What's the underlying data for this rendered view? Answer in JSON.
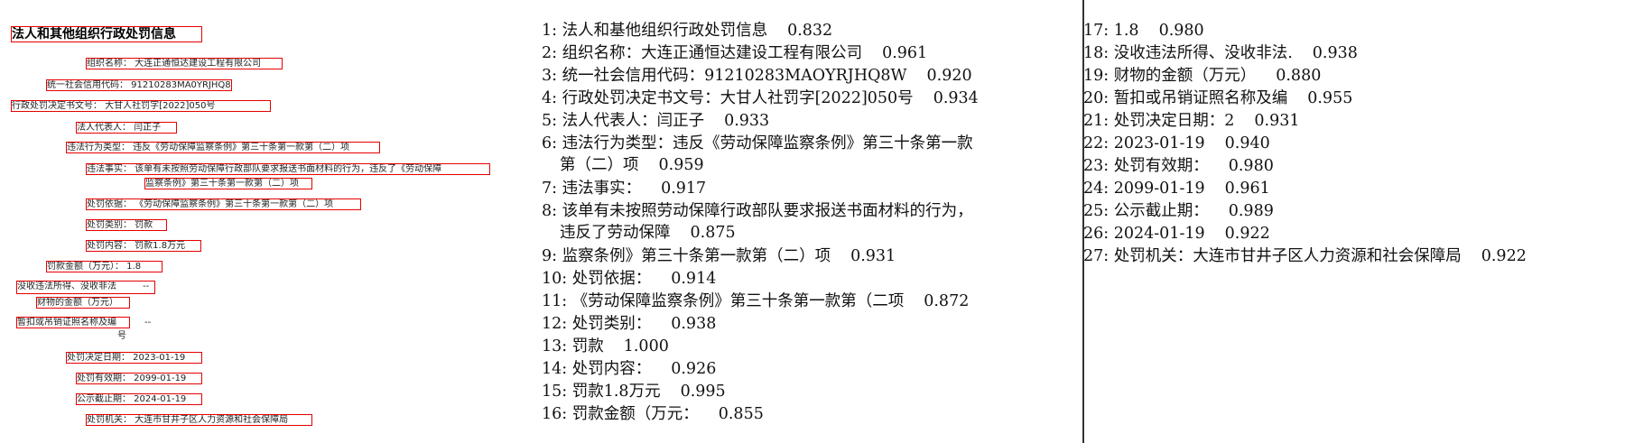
{
  "left_document": {
    "title": "法人和其他组织行政处罚信息",
    "fields": {
      "org_name": "组织名称： 大连正通恒达建设工程有限公司",
      "credit_code": "统一社会信用代码： 91210283MA0YRJHQ8W",
      "decision_no": "行政处罚决定书文号： 大甘人社罚字[2022]050号",
      "legal_rep": "法人代表人： 闫正子",
      "violation_type": "违法行为类型： 违反《劳动保障监察条例》第三十条第一款第（二）项",
      "facts_line1": "违法事实： 该单有未按照劳动保障行政部队要求报送书面材料的行为，违反了《劳动保障",
      "facts_line2": "监察条例》第三十条第一款第（二）项",
      "basis": "处罚依据： 《劳动保障监察条例》第三十条第一款第（二）项",
      "category": "处罚类别： 罚款",
      "content": "处罚内容： 罚款1.8万元",
      "amount": "罚款金额（万元）： 1.8",
      "confiscated_label": "没收违法所得、没收非法",
      "confiscated_dash": "--",
      "property_amount": "财物的金额（万元）",
      "revoked_label": "暂扣或吊销证照名称及编",
      "revoked_suffix": "号",
      "revoked_dash": "--",
      "decision_date": "处罚决定日期： 2023-01-19",
      "valid_until": "处罚有效期： 2099-01-19",
      "publicity_until": "公示截止期： 2024-01-19",
      "authority": "处罚机关： 大连市甘井子区人力资源和社会保障局"
    }
  },
  "results_middle": [
    {
      "n": "1:",
      "text": "法人和基他组织行政处罚信息",
      "score": "0.832"
    },
    {
      "n": "2:",
      "text": "组织名称：大连正通恒达建设工程有限公司",
      "score": "0.961"
    },
    {
      "n": "3:",
      "text": "统一社会信用代码：91210283MAOYRJHQ8W",
      "score": "0.920"
    },
    {
      "n": "4:",
      "text": "行政处罚决定书文号：大甘人社罚字[2022]050号",
      "score": "0.934"
    },
    {
      "n": "5:",
      "text": "法人代表人：闫正子",
      "score": "0.933"
    },
    {
      "n": "6:",
      "text": "违法行为类型：违反《劳动保障监察条例》第三十条第一款",
      "text2": "第（二）项",
      "score": "0.959"
    },
    {
      "n": "7:",
      "text": "违法事实：",
      "score": "0.917"
    },
    {
      "n": "8:",
      "text": "该单有未按照劳动保障行政部队要求报送书面材料的行为，",
      "text2": "违反了劳动保障",
      "score": "0.875"
    },
    {
      "n": "9:",
      "text": "监察条例》第三十条第一款第（二）项",
      "score": "0.931"
    },
    {
      "n": "10:",
      "text": "处罚依据：",
      "score": "0.914"
    },
    {
      "n": "11:",
      "text": "《劳动保障监察条例》第三十条第一款第（二项",
      "score": "0.872"
    },
    {
      "n": "12:",
      "text": "处罚类别：",
      "score": "0.938"
    },
    {
      "n": "13:",
      "text": "罚款",
      "score": "1.000"
    },
    {
      "n": "14:",
      "text": "处罚内容：",
      "score": "0.926"
    },
    {
      "n": "15:",
      "text": "罚款1.8万元",
      "score": "0.995"
    },
    {
      "n": "16:",
      "text": "罚款金额（万元：",
      "score": "0.855"
    }
  ],
  "results_right": [
    {
      "n": "17:",
      "text": "1.8",
      "score": "0.980"
    },
    {
      "n": "18:",
      "text": "没收违法所得、没收非法.",
      "score": "0.938"
    },
    {
      "n": "19:",
      "text": "财物的金额（万元）",
      "score": "0.880"
    },
    {
      "n": "20:",
      "text": "暂扣或吊销证照名称及编",
      "score": "0.955"
    },
    {
      "n": "21:",
      "text": "处罚决定日期：2",
      "score": "0.931"
    },
    {
      "n": "22:",
      "text": "2023-01-19",
      "score": "0.940"
    },
    {
      "n": "23:",
      "text": "处罚有效期：",
      "score": "0.980"
    },
    {
      "n": "24:",
      "text": "2099-01-19",
      "score": "0.961"
    },
    {
      "n": "25:",
      "text": "公示截止期：",
      "score": "0.989"
    },
    {
      "n": "26:",
      "text": "2024-01-19",
      "score": "0.922"
    },
    {
      "n": "27:",
      "text": "处罚机关：大连市甘井子区人力资源和社会保障局",
      "score": "0.922"
    }
  ],
  "colors": {
    "box": "#e60000",
    "divider": "#333333"
  }
}
